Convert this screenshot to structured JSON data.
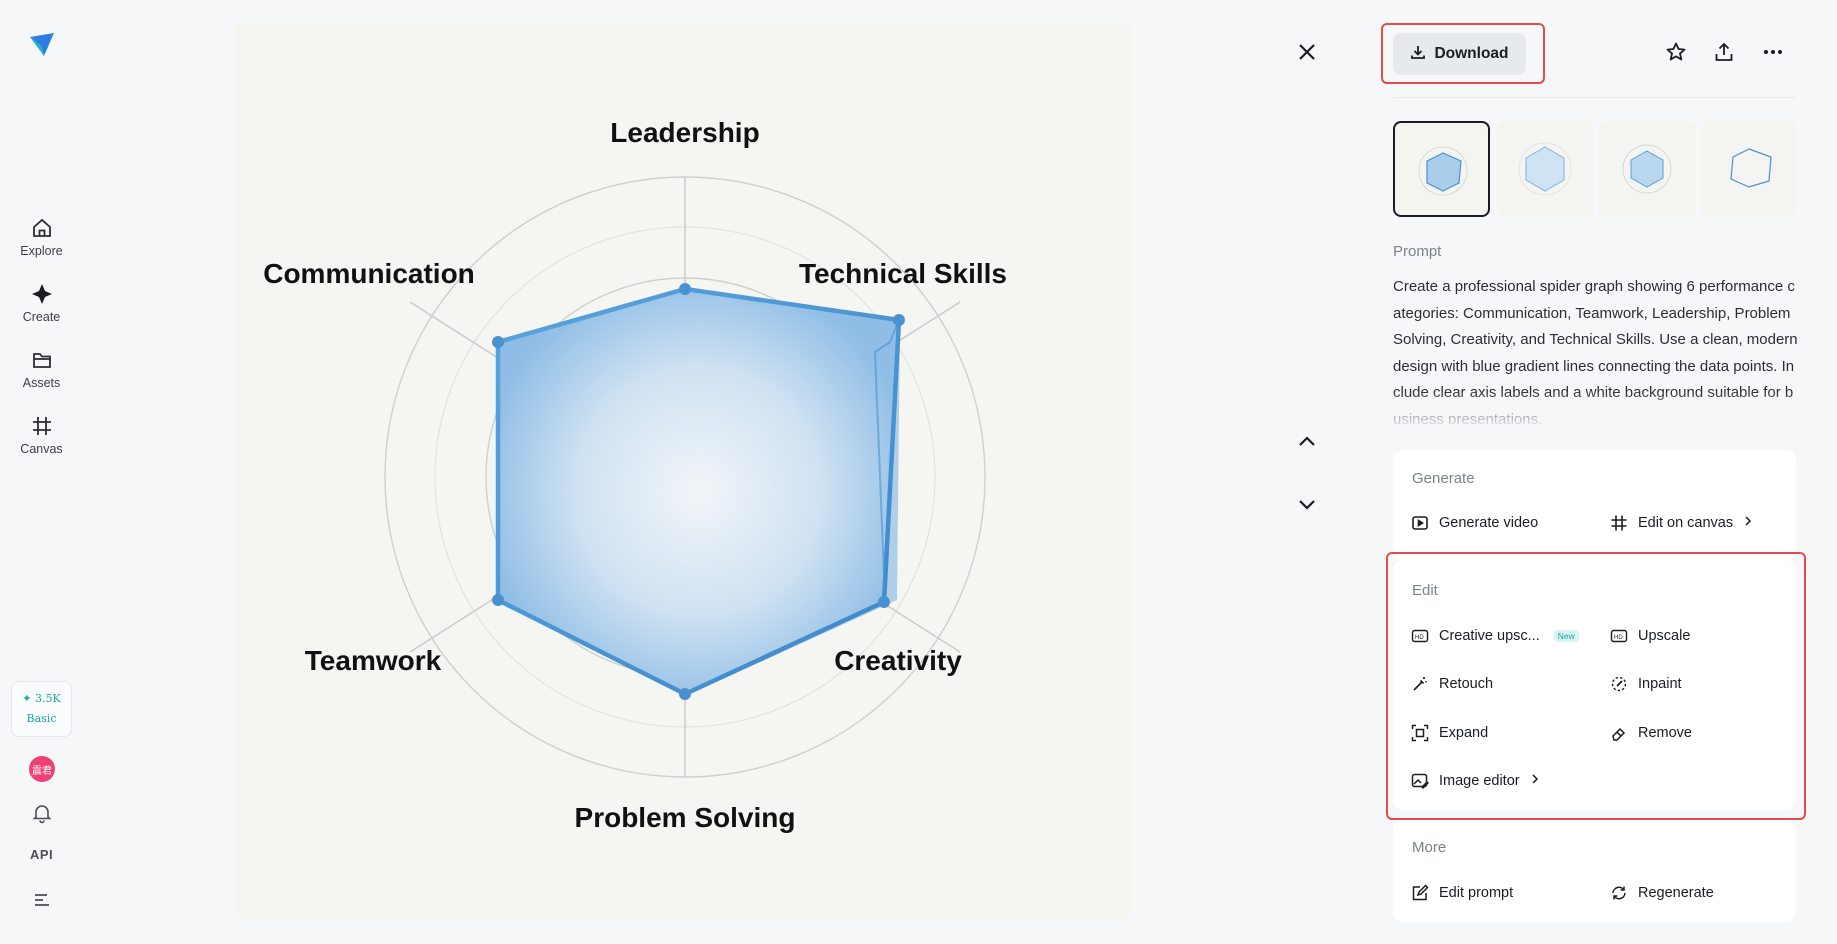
{
  "nav": {
    "items": [
      {
        "label": "Explore",
        "icon": "home-icon"
      },
      {
        "label": "Create",
        "icon": "sparkle-icon"
      },
      {
        "label": "Assets",
        "icon": "folder-icon"
      },
      {
        "label": "Canvas",
        "icon": "canvas-icon"
      }
    ],
    "credits_amount": "✦ 3.5K",
    "credits_plan": "Basic",
    "avatar_text": "震君",
    "api_label": "API"
  },
  "image": {
    "labels": {
      "top": "Leadership",
      "top_right": "Technical Skills",
      "bottom_right": "Creativity",
      "bottom": "Problem Solving",
      "bottom_left": "Teamwork",
      "top_left": "Communication"
    }
  },
  "toolbar": {
    "download_label": "Download",
    "icons": [
      "star-icon",
      "share-icon",
      "more-icon"
    ]
  },
  "prompt": {
    "label": "Prompt",
    "text": "Create a professional spider graph showing 6 performance categories: Communication, Teamwork, Leadership, Problem Solving, Creativity, and Technical Skills. Use a clean, modern design with blue gradient lines connecting the data points. Include clear axis labels and a white background suitable for business presentations."
  },
  "generate": {
    "title": "Generate",
    "generate_video": "Generate video",
    "edit_on_canvas": "Edit on canvas"
  },
  "edit": {
    "title": "Edit",
    "creative_upscale": "Creative upsc...",
    "new_badge": "New",
    "upscale": "Upscale",
    "retouch": "Retouch",
    "inpaint": "Inpaint",
    "expand": "Expand",
    "remove": "Remove",
    "image_editor": "Image editor"
  },
  "more": {
    "title": "More",
    "edit_prompt": "Edit prompt",
    "regenerate": "Regenerate"
  },
  "colors": {
    "accent_teal": "#1aa6a6",
    "highlight_red": "#e24c4c",
    "chart_blue": "#4a92cf"
  }
}
